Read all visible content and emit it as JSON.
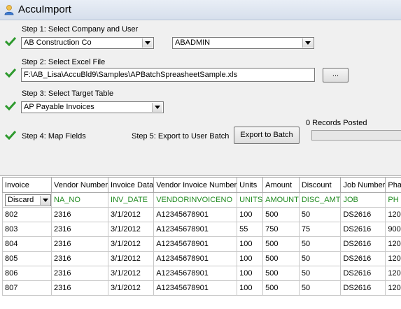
{
  "window": {
    "title": "AccuImport"
  },
  "step1": {
    "label": "Step 1:  Select  Company and User",
    "company": "AB Construction Co",
    "user": "ABADMIN"
  },
  "step2": {
    "label": "Step 2:  Select Excel File",
    "file_path": "F:\\AB_Lisa\\AccuBld9\\Samples\\APBatchSpreasheetSample.xls",
    "browse_label": "..."
  },
  "step3": {
    "label": "Step 3:  Select Target Table",
    "table": "AP Payable Invoices"
  },
  "step4": {
    "label": "Step 4:  Map Fields"
  },
  "step5": {
    "label": "Step 5:  Export to User Batch",
    "button_label": "Export to Batch",
    "records_posted": "0 Records Posted",
    "progress": 0
  },
  "grid": {
    "headers": [
      "Invoice",
      "Vendor Number",
      "Invoice Data",
      "Vendor Invoice Number",
      "Units",
      "Amount",
      "Discount",
      "Job Number",
      "Pha"
    ],
    "mapping": [
      "Discard",
      "NA_NO",
      "INV_DATE",
      "VENDORINVOICENO",
      "UNITS",
      "AMOUNT",
      "DISC_AMT",
      "JOB",
      "PH"
    ],
    "rows": [
      [
        "802",
        "2316",
        "3/1/2012",
        "A12345678901",
        "100",
        "500",
        "50",
        "DS2616",
        "120"
      ],
      [
        "803",
        "2316",
        "3/1/2012",
        "A12345678901",
        "55",
        "750",
        "75",
        "DS2616",
        "900"
      ],
      [
        "804",
        "2316",
        "3/1/2012",
        "A12345678901",
        "100",
        "500",
        "50",
        "DS2616",
        "120"
      ],
      [
        "805",
        "2316",
        "3/1/2012",
        "A12345678901",
        "100",
        "500",
        "50",
        "DS2616",
        "120"
      ],
      [
        "806",
        "2316",
        "3/1/2012",
        "A12345678901",
        "100",
        "500",
        "50",
        "DS2616",
        "120"
      ],
      [
        "807",
        "2316",
        "3/1/2012",
        "A12345678901",
        "100",
        "500",
        "50",
        "DS2616",
        "120"
      ]
    ]
  },
  "colors": {
    "check": "#2e9a2e",
    "mapping_text": "#1f8a1f"
  }
}
